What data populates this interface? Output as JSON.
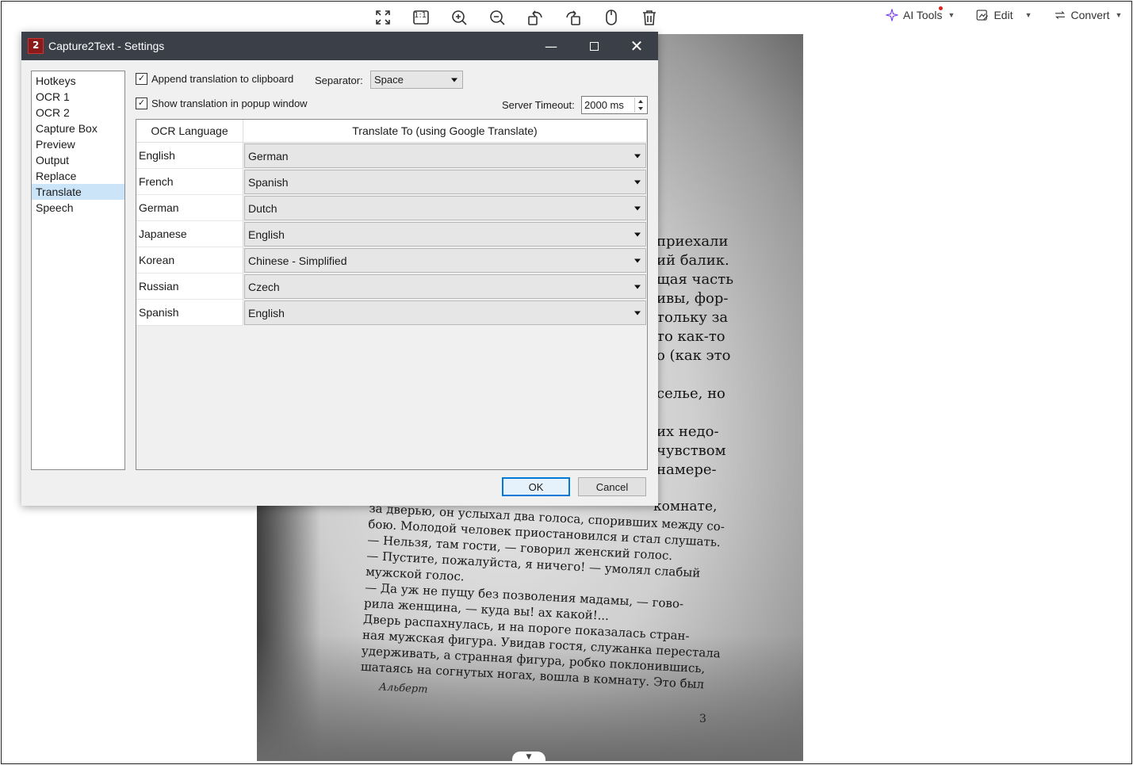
{
  "viewer_toolbar": {
    "icons": [
      "fullscreen-icon",
      "actual-size-icon",
      "zoom-in-icon",
      "zoom-out-icon",
      "rotate-left-icon",
      "rotate-right-icon",
      "mouse-icon",
      "delete-icon"
    ],
    "actual_size_glyph": "1:1"
  },
  "right_menu": {
    "ai_tools": "AI Tools",
    "edit": "Edit",
    "convert": "Convert"
  },
  "photo": {
    "right_lines": [
      "приехали",
      "ий балик.",
      "щая часть",
      "ивы, фор-",
      "тольку за",
      "то как-то",
      "о (как это",
      "",
      "селье, но",
      "",
      "их недо-",
      "чувством",
      "намере-"
    ],
    "body_lines": [
      "за дверью, он услыхал два голоса, споривших между со-",
      "бою. Молодой человек приостановился и стал слушать.",
      "— Нельзя, там гости, — говорил женский голос.",
      "— Пустите, пожалуйста, я ничего! — умолял слабый",
      "мужской голос.",
      "— Да уж не пущу без позволения мадамы, — гово-",
      "рила женщина, — куда вы! ах какой!...",
      "Дверь распахнулась, и на пороге показалась стран-",
      "ная мужская фигура. Увидав гостя, служанка перестала",
      "удерживать, а странная фигура, робко поклонившись,",
      "шатаясь на согнутых ногах, вошла в комнату. Это был"
    ],
    "top_fragment": "комнате,",
    "author": "Альберт",
    "page_number": "3"
  },
  "dialog": {
    "title": "Capture2Text - Settings",
    "sidebar": [
      "Hotkeys",
      "OCR 1",
      "OCR 2",
      "Capture Box",
      "Preview",
      "Output",
      "Replace",
      "Translate",
      "Speech"
    ],
    "selected_item": "Translate",
    "append_translation_label": "Append translation to clipboard",
    "append_translation_checked": true,
    "show_popup_label": "Show translation in popup window",
    "show_popup_checked": true,
    "separator_label": "Separator:",
    "separator_value": "Space",
    "server_timeout_label": "Server Timeout:",
    "server_timeout_value": "2000 ms",
    "table": {
      "col_ocr": "OCR Language",
      "col_translate": "Translate To (using Google Translate)",
      "rows": [
        {
          "ocr": "English",
          "target": "German"
        },
        {
          "ocr": "French",
          "target": "Spanish"
        },
        {
          "ocr": "German",
          "target": "Dutch"
        },
        {
          "ocr": "Japanese",
          "target": "English"
        },
        {
          "ocr": "Korean",
          "target": "Chinese - Simplified"
        },
        {
          "ocr": "Russian",
          "target": "Czech"
        },
        {
          "ocr": "Spanish",
          "target": "English"
        }
      ]
    },
    "ok": "OK",
    "cancel": "Cancel"
  },
  "colors": {
    "titlebar": "#3b4048",
    "selection": "#cce4f7",
    "primary_button_border": "#0078d7",
    "ai_tools_icon": "#7b3fe4"
  }
}
